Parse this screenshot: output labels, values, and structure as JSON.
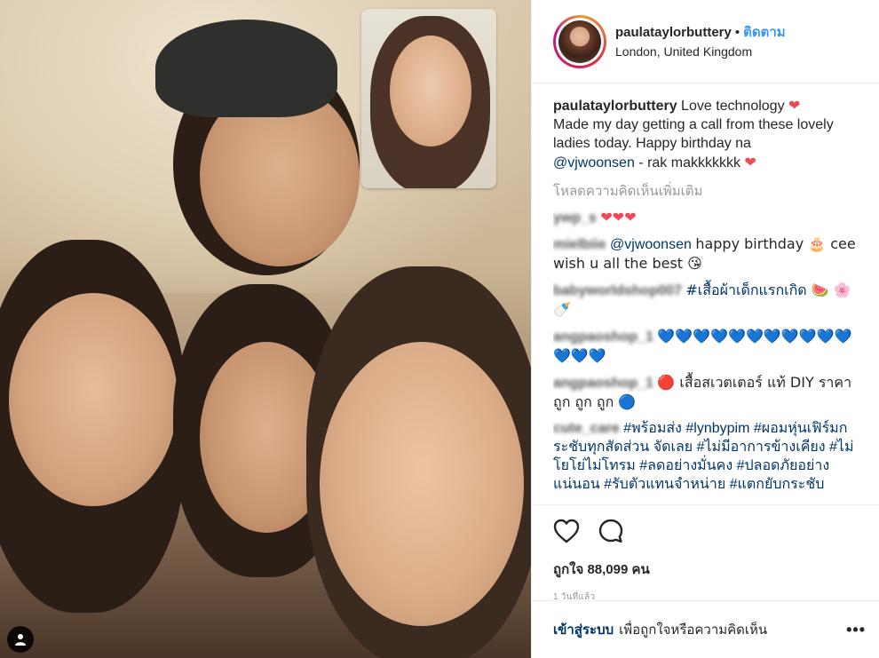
{
  "post": {
    "username": "paulataylorbuttery",
    "separator": "•",
    "follow_label": "ติดตาม",
    "location": "London, United Kingdom"
  },
  "caption": {
    "username": "paulataylorbuttery",
    "text1": "Love technology",
    "text2": "Made my day getting a call from these lovely ladies today. Happy birthday na",
    "mention": "@vjwoonsen",
    "text3": "- rak makkkkkkk"
  },
  "load_more_label": "โหลดความคิดเห็นเพิ่มเติม",
  "comments": [
    {
      "user": "ywp_s",
      "text": "❤❤❤"
    },
    {
      "user": "mielbiie",
      "mention": "@vjwoonsen",
      "text": "happy birthday 🎂 cee wish u all the best 😘"
    },
    {
      "user": "babyworldshop007",
      "text": "#เสื้อผ้าเด็กแรกเกิด 🍉 🌸🍼"
    },
    {
      "user": "angpaoshop_1",
      "text": "💙💙💙💙💙💙💙💙💙💙💙💙💙💙"
    },
    {
      "user": "angpaoshop_1",
      "text": "🔴 เสื้อสเวตเตอร์ แท้ DIY ราคา ถูก ถูก ถูก 🔵"
    },
    {
      "user": "cute_care",
      "text": "#พร้อมส่ง #lynbypim #ผอมหุ่นเฟิร์มกระชับทุกสัดส่วน จัดเลย #ไม่มีอาการข้างเคียง #ไม่โยโย่ไม่โทรม #ลดอย่างมั่นคง #ปลอดภัยอย่างแน่นอน #รับตัวแทนจำหน่าย #แตกยับกระชับ"
    }
  ],
  "likes_label": "ถูกใจ 88,099 คน",
  "time_label": "1 วันที่แล้ว",
  "login": {
    "link": "เข้าสู่ระบบ",
    "rest": "เพื่อถูกใจหรือความคิดเห็น",
    "more": "•••"
  },
  "icons": {
    "like": "heart-outline-icon",
    "comment": "speech-bubble-icon",
    "tag": "person-tag-icon",
    "more": "more-options-icon"
  },
  "colors": {
    "accent": "#3897f0",
    "link": "#003569",
    "muted": "#999999",
    "heart": "#ed4956"
  }
}
